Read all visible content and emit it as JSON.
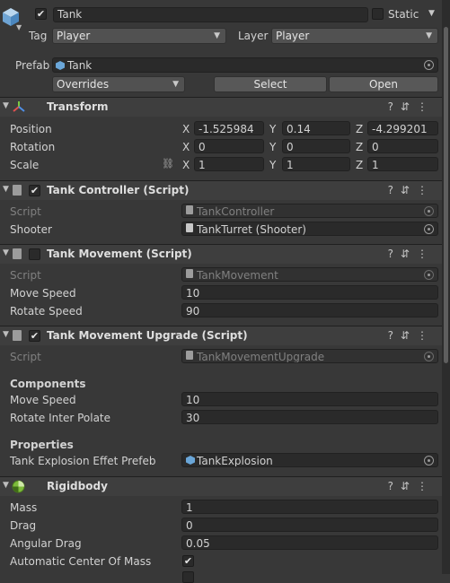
{
  "header": {
    "active_checked": true,
    "object_name": "Tank",
    "static_label": "Static",
    "tag_label": "Tag",
    "tag_value": "Player",
    "layer_label": "Layer",
    "layer_value": "Player",
    "prefab_label": "Prefab",
    "prefab_value": "Tank",
    "overrides_label": "Overrides",
    "select_label": "Select",
    "open_label": "Open"
  },
  "transform": {
    "title": "Transform",
    "rows": [
      {
        "label": "Position",
        "x": "-1.525984",
        "y": "0.14",
        "z": "-4.299201"
      },
      {
        "label": "Rotation",
        "x": "0",
        "y": "0",
        "z": "0"
      },
      {
        "label": "Scale",
        "x": "1",
        "y": "1",
        "z": "1"
      }
    ],
    "axes": {
      "x": "X",
      "y": "Y",
      "z": "Z"
    }
  },
  "tank_controller": {
    "title": "Tank Controller (Script)",
    "enabled": true,
    "script_label": "Script",
    "script_value": "TankController",
    "shooter_label": "Shooter",
    "shooter_value": "TankTurret (Shooter)"
  },
  "tank_movement": {
    "title": "Tank Movement (Script)",
    "enabled": false,
    "script_label": "Script",
    "script_value": "TankMovement",
    "move_speed_label": "Move Speed",
    "move_speed_value": "10",
    "rotate_speed_label": "Rotate Speed",
    "rotate_speed_value": "90"
  },
  "tank_movement_upgrade": {
    "title": "Tank Movement Upgrade (Script)",
    "enabled": true,
    "script_label": "Script",
    "script_value": "TankMovementUpgrade",
    "components_heading": "Components",
    "move_speed_label": "Move Speed",
    "move_speed_value": "10",
    "rotate_label": "Rotate Inter Polate",
    "rotate_value": "30",
    "properties_heading": "Properties",
    "explosion_label": "Tank Explosion Effet Prefeb",
    "explosion_value": "TankExplosion"
  },
  "rigidbody": {
    "title": "Rigidbody",
    "mass_label": "Mass",
    "mass_value": "1",
    "drag_label": "Drag",
    "drag_value": "0",
    "angular_drag_label": "Angular Drag",
    "angular_drag_value": "0.05",
    "auto_com_label": "Automatic Center Of Mass",
    "auto_com_checked": true
  },
  "glyphs": {
    "check": "✔",
    "fold": "▼",
    "arrow": "▼",
    "header_icons": "?⇵⋮",
    "unlink": "⛓"
  }
}
